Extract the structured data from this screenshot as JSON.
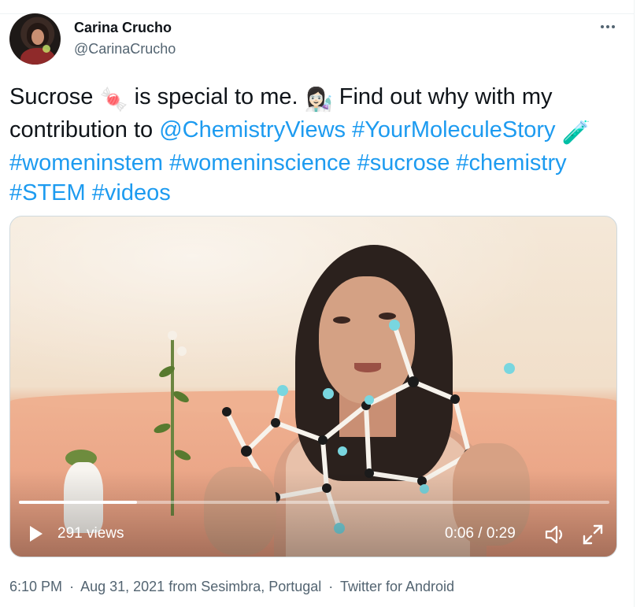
{
  "user": {
    "name": "Carina Crucho",
    "handle": "@CarinaCrucho"
  },
  "tweet": {
    "text_1": "Sucrose ",
    "emoji_candy": "🍬",
    "text_2": " is special to me. ",
    "emoji_scientist": "👩🏻‍🔬",
    "text_3": " Find out why with my contribution to ",
    "mention": "@ChemistryViews",
    "hashtag_1": "#YourMoleculeStory",
    "emoji_test_tube": "🧪",
    "hashtag_2": "#womeninstem",
    "hashtag_3": "#womeninscience",
    "hashtag_4": "#sucrose",
    "hashtag_5": "#chemistry",
    "hashtag_6": "#STEM",
    "hashtag_7": "#videos"
  },
  "video": {
    "views": "291 views",
    "time": "0:06 / 0:29",
    "progress_fraction": 0.2
  },
  "footer": {
    "time": "6:10 PM",
    "date": "Aug 31, 2021",
    "location_text": "from Sesimbra, Portugal",
    "source": "Twitter for Android",
    "separator": "·"
  },
  "icons": {
    "more": "more-icon",
    "play": "play-icon",
    "volume": "volume-icon",
    "fullscreen": "fullscreen-icon"
  },
  "colors": {
    "link": "#1d9bf0",
    "text": "#0f1419",
    "secondary": "#536471"
  }
}
